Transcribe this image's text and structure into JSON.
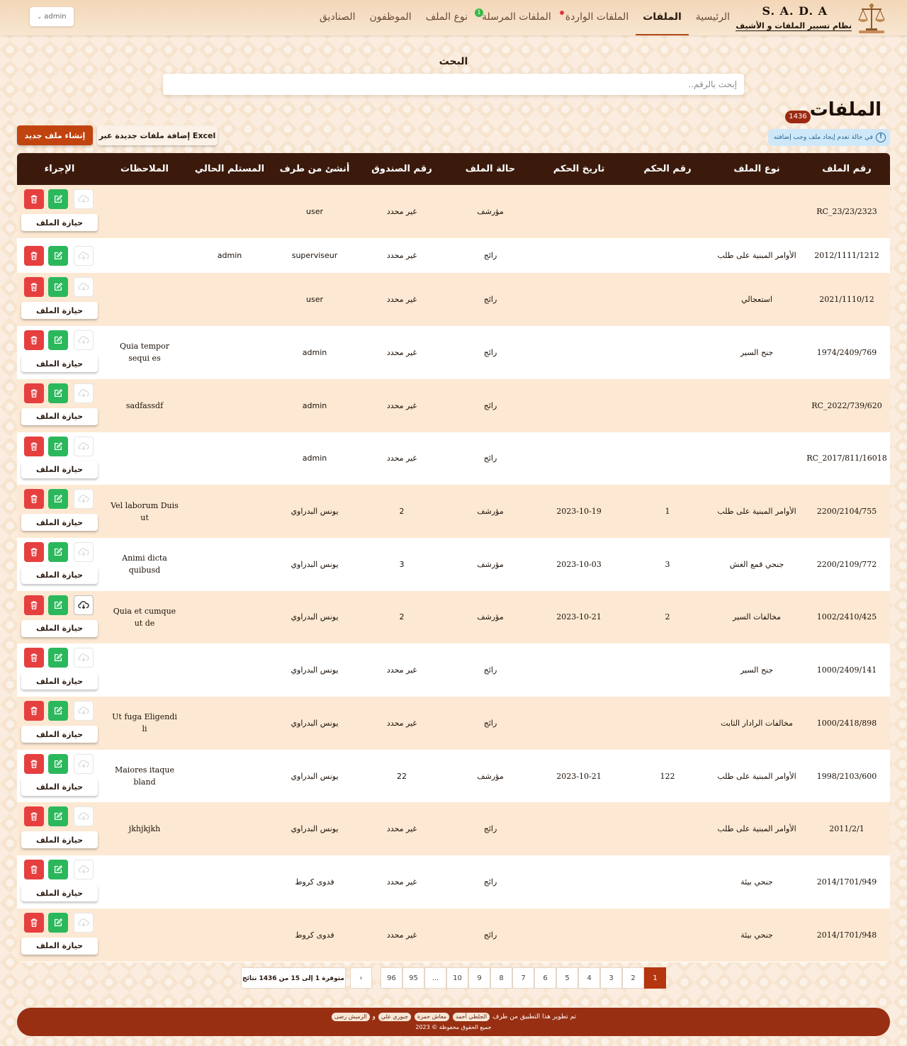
{
  "app": {
    "logo_title": "S. A. D. A",
    "logo_subtitle": "نظام تسيير الملفات و الأشيف"
  },
  "nav": {
    "items": [
      {
        "label": "الرئيسية",
        "active": false
      },
      {
        "label": "الملفات",
        "active": true
      },
      {
        "label": "الملفات الواردة",
        "active": false
      },
      {
        "label": "الملفات المرسلة",
        "active": false
      },
      {
        "label": "نوع الملف",
        "active": false
      },
      {
        "label": "الموظفون",
        "active": false
      },
      {
        "label": "الصناديق",
        "active": false
      }
    ],
    "sent_badge": "1",
    "user_menu": "admin"
  },
  "search": {
    "label": "البحث",
    "placeholder": "إبحث بالرقم..",
    "value": ""
  },
  "page": {
    "title": "الملفات",
    "count": "1436",
    "info_note": "في حالة تعدم إيجاد ملف وجب إضافته",
    "create_button": "إنشاء ملف جديد",
    "excel_button": "إضافة ملفات جديدة عبر Excel"
  },
  "table": {
    "headers": {
      "number": "رقم الملف",
      "type": "نوع الملف",
      "judgment_number": "رقم الحكم",
      "judgment_date": "تاريخ الحكم",
      "status": "حالة الملف",
      "box": "رقم الصندوق",
      "created_by": "أنشئ من طرف",
      "receiver": "المستلم الحالي",
      "notes": "الملاحظات",
      "action": "الإجراء"
    },
    "hold_label": "حيازة الملف",
    "rows": [
      {
        "number": "RC_23/23/2323",
        "type": "",
        "judgment_number": "",
        "judgment_date": "",
        "status": "مؤرشف",
        "box": "غير محدد",
        "created_by": "user",
        "receiver": "",
        "notes": "",
        "download": false,
        "hold": true
      },
      {
        "number": "2012/1111/1212",
        "type": "الأوامر المبنية على طلب",
        "judgment_number": "",
        "judgment_date": "",
        "status": "رائج",
        "box": "غير محدد",
        "created_by": "superviseur",
        "receiver": "admin",
        "notes": "",
        "download": false,
        "hold": false
      },
      {
        "number": "2021/1110/12",
        "type": "استعجالي",
        "judgment_number": "",
        "judgment_date": "",
        "status": "رائج",
        "box": "غير محدد",
        "created_by": "user",
        "receiver": "",
        "notes": "",
        "download": false,
        "hold": true
      },
      {
        "number": "1974/2409/769",
        "type": "جنح السير",
        "judgment_number": "",
        "judgment_date": "",
        "status": "رائج",
        "box": "غير محدد",
        "created_by": "admin",
        "receiver": "",
        "notes": "Quia tempor sequi es",
        "download": false,
        "hold": true
      },
      {
        "number": "RC_2022/739/620",
        "type": "",
        "judgment_number": "",
        "judgment_date": "",
        "status": "رائج",
        "box": "غير محدد",
        "created_by": "admin",
        "receiver": "",
        "notes": "sadfassdf",
        "download": false,
        "hold": true
      },
      {
        "number": "RC_2017/811/16018",
        "type": "",
        "judgment_number": "",
        "judgment_date": "",
        "status": "رائج",
        "box": "غير محدد",
        "created_by": "admin",
        "receiver": "",
        "notes": "",
        "download": false,
        "hold": true
      },
      {
        "number": "2200/2104/755",
        "type": "الأوامر المبنية على طلب",
        "judgment_number": "1",
        "judgment_date": "2023-10-19",
        "status": "مؤرشف",
        "box": "2",
        "created_by": "يونس البدراوي",
        "receiver": "",
        "notes": "Vel laborum Duis ut",
        "download": false,
        "hold": true
      },
      {
        "number": "2200/2109/772",
        "type": "جنحي قمع الغش",
        "judgment_number": "3",
        "judgment_date": "2023-10-03",
        "status": "مؤرشف",
        "box": "3",
        "created_by": "يونس البدراوي",
        "receiver": "",
        "notes": "Animi dicta quibusd",
        "download": false,
        "hold": true
      },
      {
        "number": "1002/2410/425",
        "type": "مخالفات السير",
        "judgment_number": "2",
        "judgment_date": "2023-10-21",
        "status": "مؤرشف",
        "box": "2",
        "created_by": "يونس البدراوي",
        "receiver": "",
        "notes": "Quia et cumque ut de",
        "download": true,
        "hold": true
      },
      {
        "number": "1000/2409/141",
        "type": "جنح السير",
        "judgment_number": "",
        "judgment_date": "",
        "status": "رائج",
        "box": "غير محدد",
        "created_by": "يونس البدراوي",
        "receiver": "",
        "notes": "",
        "download": false,
        "hold": true
      },
      {
        "number": "1000/2418/898",
        "type": "مخالفات الرادار الثابت",
        "judgment_number": "",
        "judgment_date": "",
        "status": "رائج",
        "box": "غير محدد",
        "created_by": "يونس البدراوي",
        "receiver": "",
        "notes": "Ut fuga Eligendi li",
        "download": false,
        "hold": true
      },
      {
        "number": "1998/2103/600",
        "type": "الأوامر المبنية على طلب",
        "judgment_number": "122",
        "judgment_date": "2023-10-21",
        "status": "مؤرشف",
        "box": "22",
        "created_by": "يونس البدراوي",
        "receiver": "",
        "notes": "Maiores itaque bland",
        "download": false,
        "hold": true
      },
      {
        "number": "2011/2/1",
        "type": "الأوامر المبنية على طلب",
        "judgment_number": "",
        "judgment_date": "",
        "status": "رائج",
        "box": "غير محدد",
        "created_by": "يونس البدراوي",
        "receiver": "",
        "notes": "jkhjkjkh",
        "download": false,
        "hold": true
      },
      {
        "number": "2014/1701/949",
        "type": "جنحي بيئة",
        "judgment_number": "",
        "judgment_date": "",
        "status": "رائج",
        "box": "غير محدد",
        "created_by": "فدوى كروط",
        "receiver": "",
        "notes": "",
        "download": false,
        "hold": true
      },
      {
        "number": "2014/1701/948",
        "type": "جنحي بيئة",
        "judgment_number": "",
        "judgment_date": "",
        "status": "رائج",
        "box": "غير محدد",
        "created_by": "فدوى كروط",
        "receiver": "",
        "notes": "",
        "download": false,
        "hold": true
      }
    ]
  },
  "pagination": {
    "pages": [
      "1",
      "2",
      "3",
      "4",
      "5",
      "6",
      "7",
      "8",
      "9",
      "10",
      "...",
      "95",
      "96"
    ],
    "current": "1",
    "next": "›",
    "info": "متوفرة 1 إلى 15 من 1436 نتائج"
  },
  "footer": {
    "line1_prefix": "تم تطوير هذا التطبيق من طرف",
    "developers": [
      "الجلطي أحمد",
      "معاش حمزة",
      "جبوري علي"
    ],
    "and": "و",
    "last_developer": "الرميش رضى",
    "line2": "جميع الحقوق محفوظة © 2023"
  },
  "colors": {
    "header_row": "#3b1a0c",
    "accent": "#c1440f",
    "footer": "#982f12",
    "odd_row": "#fde9d3"
  }
}
